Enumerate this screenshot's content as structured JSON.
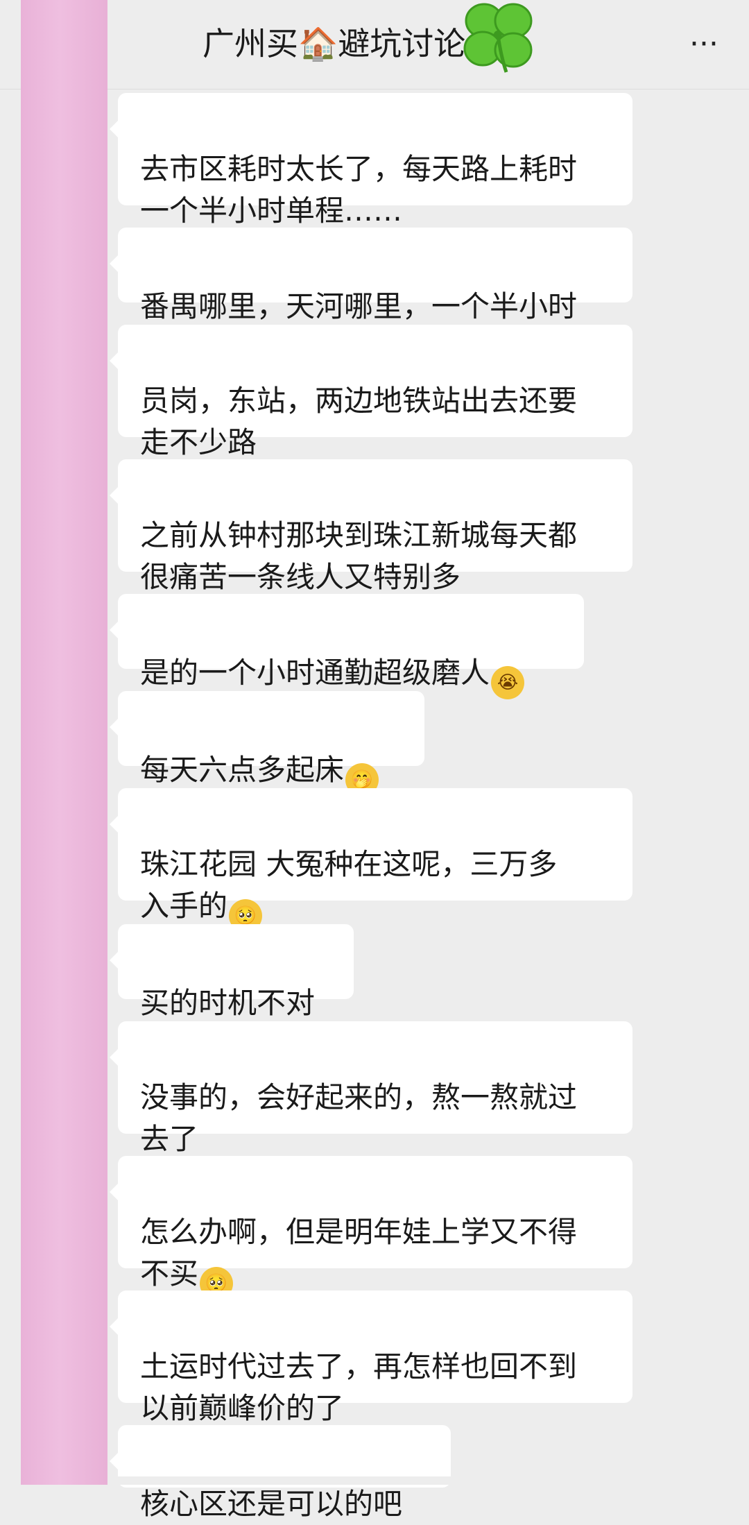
{
  "header": {
    "title": "广州买🏠避坑讨论",
    "more_label": "···"
  },
  "messages": [
    {
      "text": "去市区耗时太长了，每天路上耗时\n一个半小时单程……",
      "emoji": ""
    },
    {
      "text": "番禺哪里，天河哪里，一个半小时",
      "emoji": ""
    },
    {
      "text": "员岗，东站，两边地铁站出去还要\n走不少路",
      "emoji": ""
    },
    {
      "text": "之前从钟村那块到珠江新城每天都\n很痛苦一条线人又特别多",
      "emoji": ""
    },
    {
      "text": "是的一个小时通勤超级磨人",
      "emoji": "😭"
    },
    {
      "text": "每天六点多起床",
      "emoji": "🤭"
    },
    {
      "text": "珠江花园 大冤种在这呢，三万多\n入手的",
      "emoji": "🥺"
    },
    {
      "text": "买的时机不对",
      "emoji": ""
    },
    {
      "text": "没事的，会好起来的，熬一熬就过\n去了",
      "emoji": ""
    },
    {
      "text": "怎么办啊，但是明年娃上学又不得\n不买",
      "emoji": "🥺"
    },
    {
      "text": "土运时代过去了，再怎样也回不到\n以前巅峰价的了",
      "emoji": ""
    },
    {
      "text": "核心区还是可以的吧",
      "emoji": ""
    }
  ]
}
